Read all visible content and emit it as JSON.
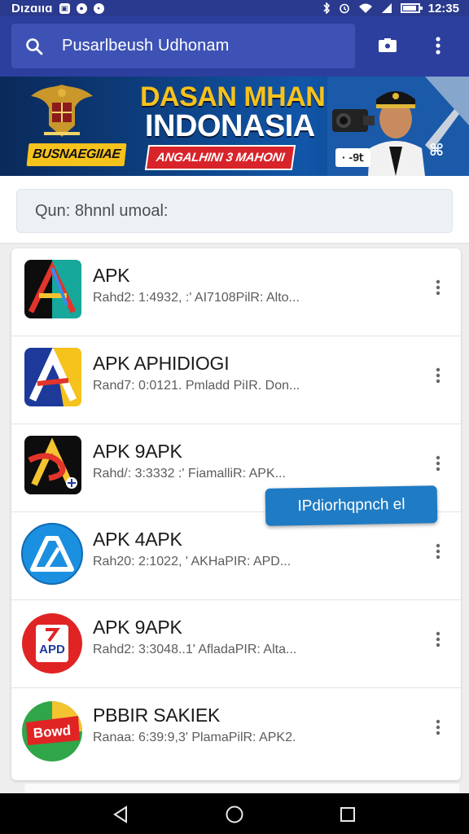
{
  "status_bar": {
    "carrier": "Dızɑııɑ",
    "time": "12:35",
    "battery_fraction": 0.9,
    "icons": [
      "image-icon",
      "notification-icon",
      "message-icon",
      "bluetooth-icon",
      "alarm-icon",
      "wifi-icon",
      "signal-icon",
      "battery-icon"
    ]
  },
  "app_bar": {
    "search_text": "Pusarlbeush Udhonam",
    "icons": [
      "search-icon",
      "camera-icon",
      "more-vert-icon"
    ]
  },
  "banner": {
    "chip": "BUSNAEGIIAE",
    "title_line1": "DASAN MHAN",
    "title_line2": "INDONASIA",
    "ribbon": "ANGALHINI 3 MAHONI",
    "tag": "· -9𝗍",
    "corner": "⌘",
    "colors": {
      "gold": "#f6c21c",
      "red": "#d8232a",
      "navy": "#0d3d7c"
    }
  },
  "filter": {
    "placeholder": "Qun: 8hnnl umoal:"
  },
  "apps": [
    {
      "name": "APK",
      "meta": "Rahd2: 1:4932, :' AI7108PilR: Alto...",
      "icon": "apk-triangle-teal-icon"
    },
    {
      "name": "APK APHIDIOGI",
      "meta": "Rand7: 0:0121. Pmladd PiIR. Don...",
      "icon": "apk-triangle-blue-yellow-icon"
    },
    {
      "name": "APK 9APK",
      "meta": "Rahd/: 3:3332 :' FiamalliR: APK...",
      "icon": "apk-triangle-red-black-icon"
    },
    {
      "name": "APK 4APK",
      "meta": "Rah20: 2:1022, ' AKHaPIR: APD...",
      "icon": "apk-triangle-circle-blue-icon"
    },
    {
      "name": "APK 9APK",
      "meta": "Rahd2: 3:3048..1' AfladaPIR: Alta...",
      "icon": "apd-red-circle-icon"
    },
    {
      "name": "PBBIR SAKIEK",
      "meta": "Ranaa: 6:39:9,3' PlamaPilR: APK2.",
      "icon": "bowd-green-circle-icon"
    }
  ],
  "toast": {
    "label": "IPdiorhqpnch el",
    "color": "#1f7bc4"
  },
  "nav_bar": {
    "icons": [
      "back-icon",
      "home-icon",
      "recents-icon"
    ]
  }
}
